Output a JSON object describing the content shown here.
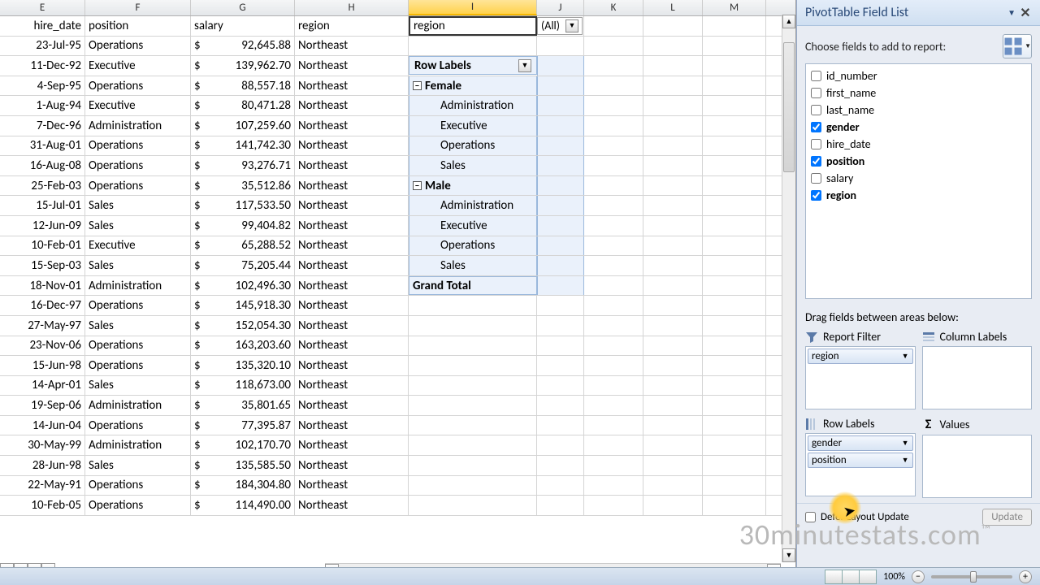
{
  "columns": [
    "E",
    "F",
    "G",
    "H",
    "I",
    "J",
    "K",
    "L",
    "M"
  ],
  "selected_column": "I",
  "headers": {
    "E": "hire_date",
    "F": "position",
    "G": "salary",
    "H": "region"
  },
  "pivot_filter": {
    "label": "region",
    "value": "(All)"
  },
  "pivot": {
    "row_labels": "Row Labels",
    "groups": [
      {
        "name": "Female",
        "items": [
          "Administration",
          "Executive",
          "Operations",
          "Sales"
        ]
      },
      {
        "name": "Male",
        "items": [
          "Administration",
          "Executive",
          "Operations",
          "Sales"
        ]
      }
    ],
    "grand_total": "Grand Total"
  },
  "data_rows": [
    {
      "E": "23-Jul-95",
      "F": "Operations",
      "G": "92,645.88",
      "H": "Northeast"
    },
    {
      "E": "11-Dec-92",
      "F": "Executive",
      "G": "139,962.70",
      "H": "Northeast"
    },
    {
      "E": "4-Sep-95",
      "F": "Operations",
      "G": "88,557.18",
      "H": "Northeast"
    },
    {
      "E": "1-Aug-94",
      "F": "Executive",
      "G": "80,471.28",
      "H": "Northeast"
    },
    {
      "E": "7-Dec-96",
      "F": "Administration",
      "G": "107,259.60",
      "H": "Northeast"
    },
    {
      "E": "31-Aug-01",
      "F": "Operations",
      "G": "141,742.30",
      "H": "Northeast"
    },
    {
      "E": "16-Aug-08",
      "F": "Operations",
      "G": "93,276.71",
      "H": "Northeast"
    },
    {
      "E": "25-Feb-03",
      "F": "Operations",
      "G": "35,512.86",
      "H": "Northeast"
    },
    {
      "E": "15-Jul-01",
      "F": "Sales",
      "G": "117,533.50",
      "H": "Northeast"
    },
    {
      "E": "12-Jun-09",
      "F": "Sales",
      "G": "99,404.82",
      "H": "Northeast"
    },
    {
      "E": "10-Feb-01",
      "F": "Executive",
      "G": "65,288.52",
      "H": "Northeast"
    },
    {
      "E": "15-Sep-03",
      "F": "Sales",
      "G": "75,205.44",
      "H": "Northeast"
    },
    {
      "E": "18-Nov-01",
      "F": "Administration",
      "G": "102,496.30",
      "H": "Northeast"
    },
    {
      "E": "16-Dec-97",
      "F": "Operations",
      "G": "145,918.30",
      "H": "Northeast"
    },
    {
      "E": "27-May-97",
      "F": "Sales",
      "G": "152,054.30",
      "H": "Northeast"
    },
    {
      "E": "23-Nov-06",
      "F": "Operations",
      "G": "163,203.60",
      "H": "Northeast"
    },
    {
      "E": "15-Jun-98",
      "F": "Operations",
      "G": "135,320.10",
      "H": "Northeast"
    },
    {
      "E": "14-Apr-01",
      "F": "Sales",
      "G": "118,673.00",
      "H": "Northeast"
    },
    {
      "E": "19-Sep-06",
      "F": "Administration",
      "G": "35,801.65",
      "H": "Northeast"
    },
    {
      "E": "14-Jun-04",
      "F": "Operations",
      "G": "77,395.87",
      "H": "Northeast"
    },
    {
      "E": "30-May-99",
      "F": "Administration",
      "G": "102,170.70",
      "H": "Northeast"
    },
    {
      "E": "28-Jun-98",
      "F": "Sales",
      "G": "135,585.50",
      "H": "Northeast"
    },
    {
      "E": "22-May-91",
      "F": "Operations",
      "G": "184,304.80",
      "H": "Northeast"
    },
    {
      "E": "10-Feb-05",
      "F": "Operations",
      "G": "114,490.00",
      "H": "Northeast"
    }
  ],
  "currency_symbol": "$",
  "pane": {
    "title": "PivotTable Field List",
    "choose": "Choose fields to add to report:",
    "fields": [
      {
        "name": "id_number",
        "checked": false,
        "bold": false
      },
      {
        "name": "first_name",
        "checked": false,
        "bold": false
      },
      {
        "name": "last_name",
        "checked": false,
        "bold": false
      },
      {
        "name": "gender",
        "checked": true,
        "bold": true
      },
      {
        "name": "hire_date",
        "checked": false,
        "bold": false
      },
      {
        "name": "position",
        "checked": true,
        "bold": true
      },
      {
        "name": "salary",
        "checked": false,
        "bold": false
      },
      {
        "name": "region",
        "checked": true,
        "bold": true
      }
    ],
    "drag_label": "Drag fields between areas below:",
    "area_report_filter": "Report Filter",
    "area_column_labels": "Column Labels",
    "area_row_labels": "Row Labels",
    "area_values": "Values",
    "report_filter_items": [
      "region"
    ],
    "row_label_items": [
      "gender",
      "position"
    ],
    "defer": "Defer Layout Update",
    "update": "Update"
  },
  "status": {
    "zoom": "100%"
  },
  "watermark": "30minutestats.com"
}
